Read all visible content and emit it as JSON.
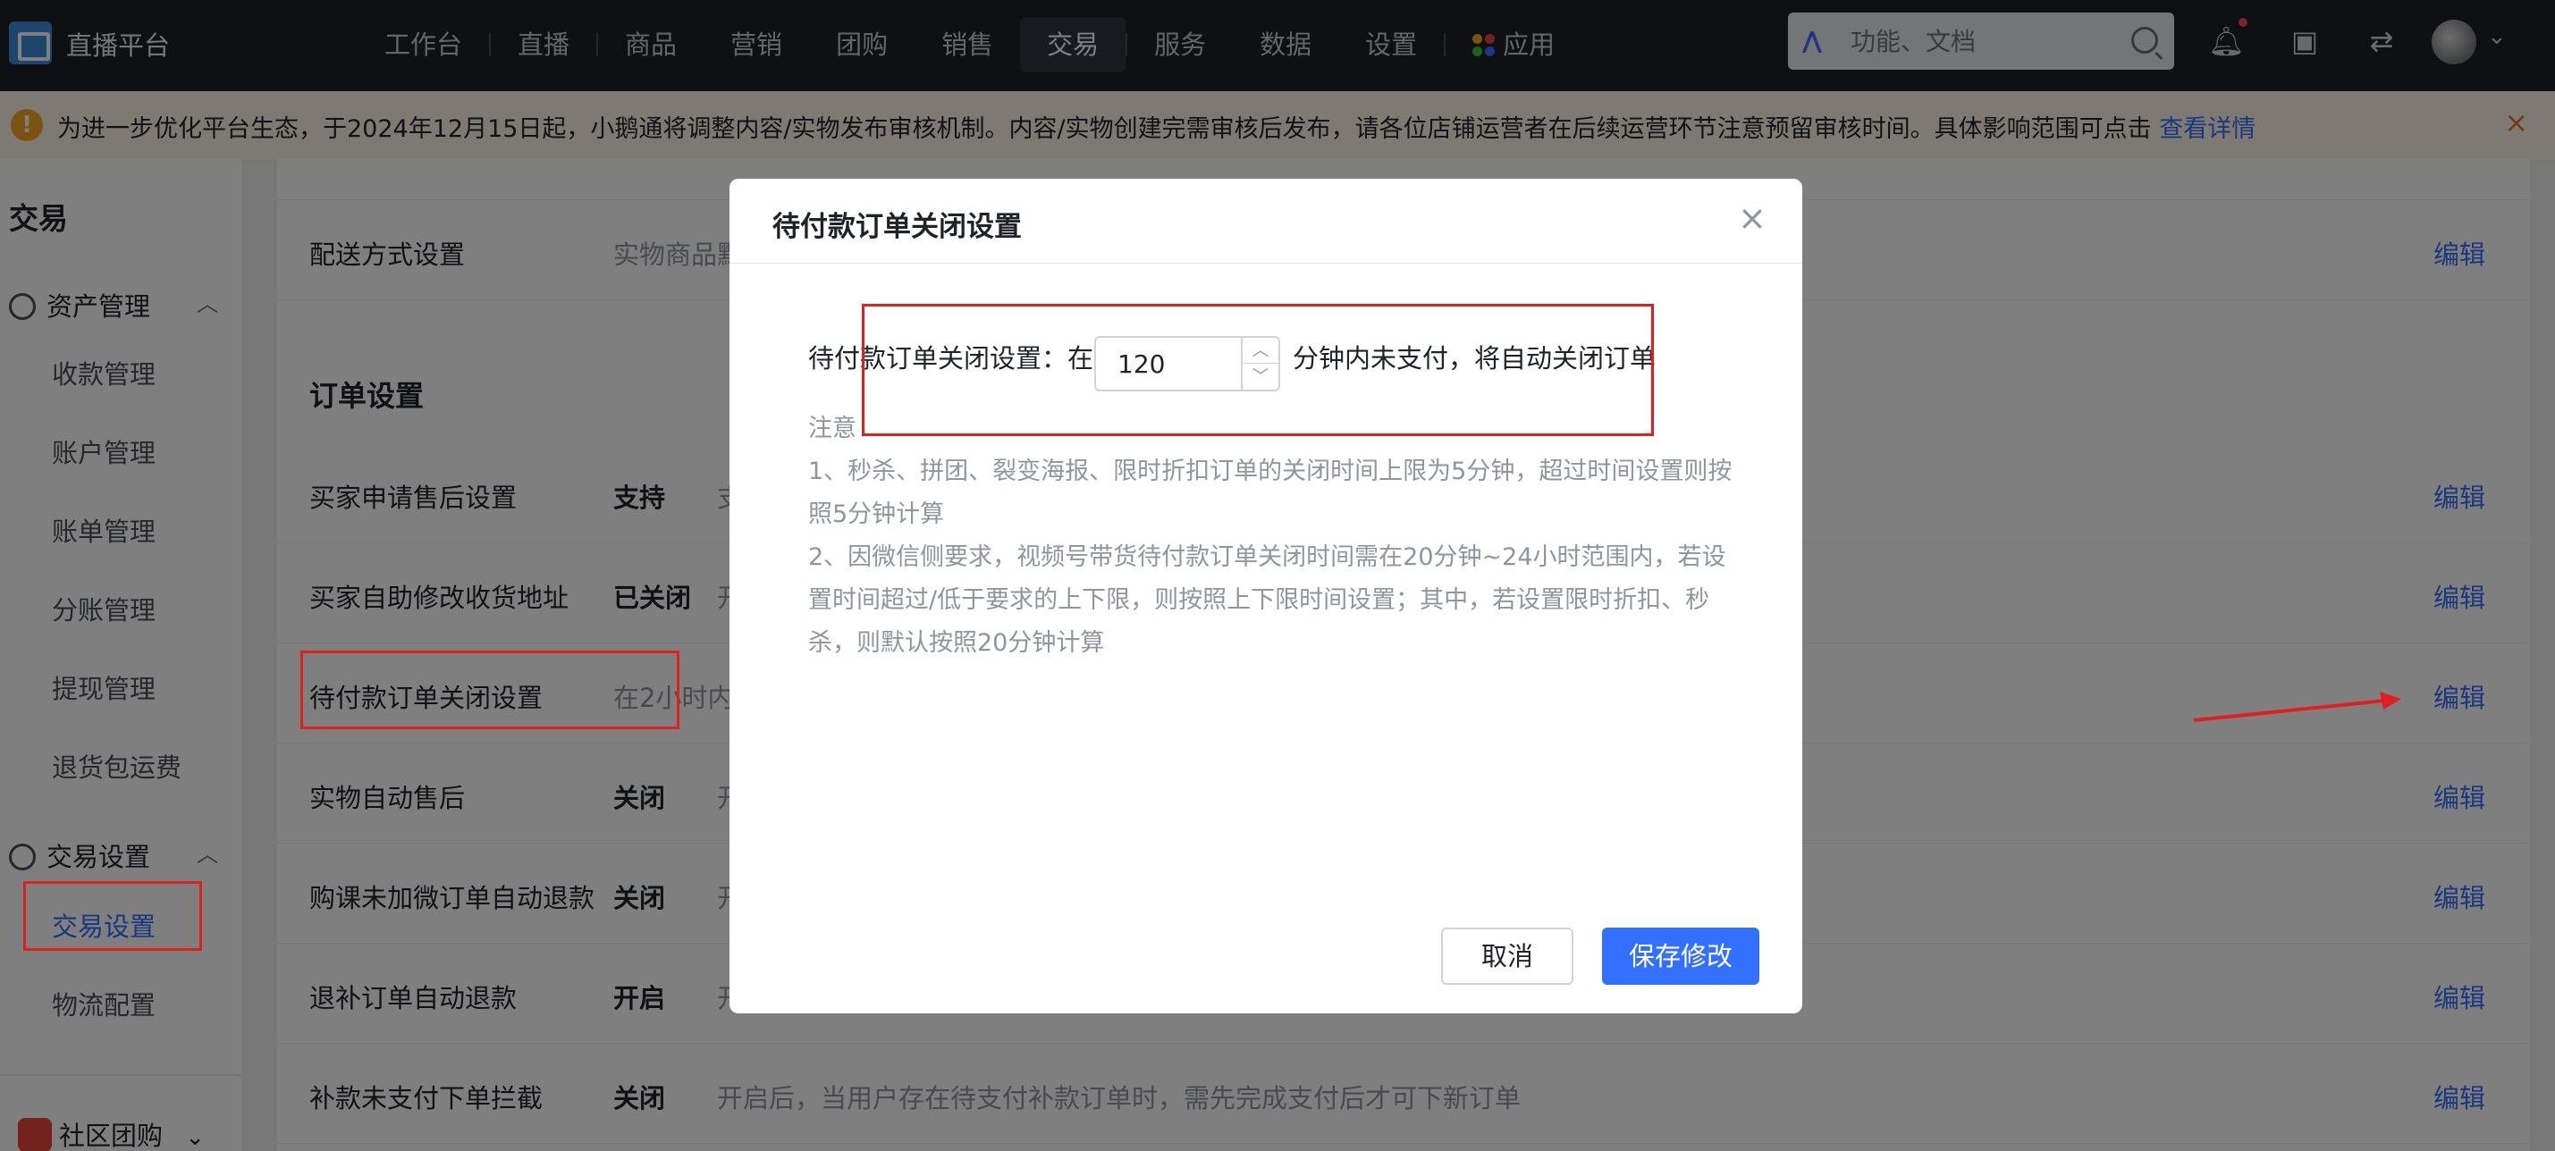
{
  "header": {
    "app_title": "直播平台",
    "nav": [
      "工作台",
      "直播",
      "商品",
      "营销",
      "团购",
      "销售",
      "交易",
      "服务",
      "数据",
      "设置",
      "应用"
    ],
    "active_nav": "交易",
    "search_placeholder": "功能、文档",
    "icons": [
      "search-icon",
      "bell-icon",
      "store-icon",
      "switch-icon",
      "avatar"
    ]
  },
  "notice": {
    "text": "为进一步优化平台生态，于2024年12月15日起，小鹅通将调整内容/实物发布审核机制。内容/实物创建完需审核后发布，请各位店铺运营者在后续运营环节注意预留审核时间。具体影响范围可点击",
    "link": "查看详情",
    "close": "×"
  },
  "sidebar": {
    "title": "交易",
    "groups": [
      {
        "label": "资产管理",
        "items": [
          "收款管理",
          "账户管理",
          "账单管理",
          "分账管理",
          "提现管理",
          "退货包运费"
        ]
      },
      {
        "label": "交易设置",
        "items": [
          "交易设置",
          "物流配置"
        ]
      }
    ],
    "active_item": "交易设置",
    "community": "社区团购"
  },
  "main": {
    "top_row": {
      "label": "配送方式设置",
      "desc": "实物商品默",
      "edit": "编辑"
    },
    "section_title": "订单设置",
    "rows": [
      {
        "label": "买家申请售后设置",
        "status": "支持",
        "desc": "支",
        "edit": "编辑"
      },
      {
        "label": "买家自助修改收货地址",
        "status": "已关闭",
        "desc": "开",
        "edit": "编辑"
      },
      {
        "label": "待付款订单关闭设置",
        "status": "",
        "desc": "在2小时内",
        "edit": "编辑"
      },
      {
        "label": "实物自动售后",
        "status": "关闭",
        "desc": "开",
        "edit": "编辑"
      },
      {
        "label": "购课未加微订单自动退款",
        "status": "关闭",
        "desc": "开",
        "edit": "编辑"
      },
      {
        "label": "退补订单自动退款",
        "status": "开启",
        "desc": "开",
        "edit": "编辑"
      },
      {
        "label": "补款未支付下单拦截",
        "status": "关闭",
        "desc": "开启后，当用户存在待支付补款订单时，需先完成支付后才可下新订单",
        "edit": "编辑"
      }
    ]
  },
  "modal": {
    "title": "待付款订单关闭设置",
    "close": "×",
    "prefix": "待付款订单关闭设置：在",
    "minutes_value": "120",
    "suffix": "分钟内未支付，将自动关闭订单",
    "notes": [
      "注意",
      "1、秒杀、拼团、裂变海报、限时折扣订单的关闭时间上限为5分钟，超过时间设置则按照5分钟计算",
      "2、因微信侧要求，视频号带货待付款订单关闭时间需在20分钟~24小时范围内，若设置时间超过/低于要求的上下限，则按照上下限时间设置；其中，若设置限时折扣、秒杀，则默认按照20分钟计算"
    ],
    "cancel": "取消",
    "save": "保存修改"
  },
  "colors": {
    "primary": "#3370ff",
    "nav_bg": "#1c2029",
    "annotation": "#e02020"
  }
}
